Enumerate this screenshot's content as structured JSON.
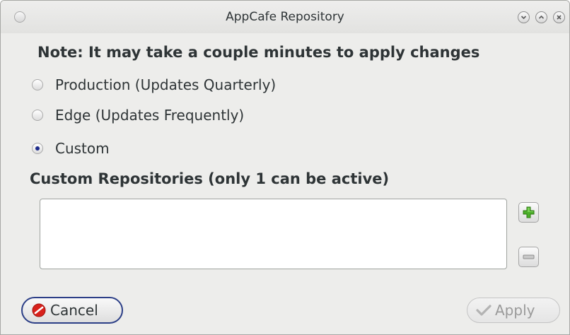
{
  "window": {
    "title": "AppCafe Repository"
  },
  "note": "Note: It may take a couple minutes to apply changes",
  "repo_options": [
    {
      "label": "Production (Updates Quarterly)",
      "checked": false
    },
    {
      "label": "Edge (Updates Frequently)",
      "checked": false
    },
    {
      "label": "Custom",
      "checked": true
    }
  ],
  "custom_heading": "Custom Repositories (only 1 can be active)",
  "custom_list": [],
  "buttons": {
    "cancel": "Cancel",
    "apply": "Apply"
  },
  "colors": {
    "accent": "#1c2a8a",
    "add": "#4caf2a",
    "cancel_icon": "#d8211c"
  },
  "icons": [
    "minimize-icon",
    "maximize-icon",
    "close-icon",
    "plus-icon",
    "minus-icon",
    "cancel-icon",
    "check-icon"
  ]
}
